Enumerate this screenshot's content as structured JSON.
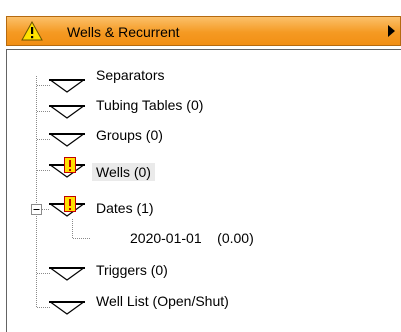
{
  "header": {
    "title": "Wells & Recurrent",
    "colors": {
      "bar_top": "#fbc06a",
      "bar_bottom": "#f28f14",
      "warning": "#ffe100"
    }
  },
  "tree": {
    "items": [
      {
        "label": "Separators",
        "icon": "triangle-down-icon",
        "warning": false
      },
      {
        "label": "Tubing Tables (0)",
        "icon": "triangle-down-icon",
        "warning": false
      },
      {
        "label": "Groups (0)",
        "icon": "triangle-down-icon",
        "warning": false
      },
      {
        "label": "Wells (0)",
        "icon": "triangle-down-icon",
        "warning": true,
        "selected": true
      },
      {
        "label": "Dates (1)",
        "icon": "triangle-down-icon",
        "warning": true,
        "expanded": true
      },
      {
        "label": "2020-01-01    (0.00)",
        "icon": "",
        "warning": false,
        "child": true
      },
      {
        "label": "Triggers (0)",
        "icon": "triangle-down-icon",
        "warning": false
      },
      {
        "label": "Well List (Open/Shut)",
        "icon": "triangle-down-icon",
        "warning": false
      }
    ]
  }
}
